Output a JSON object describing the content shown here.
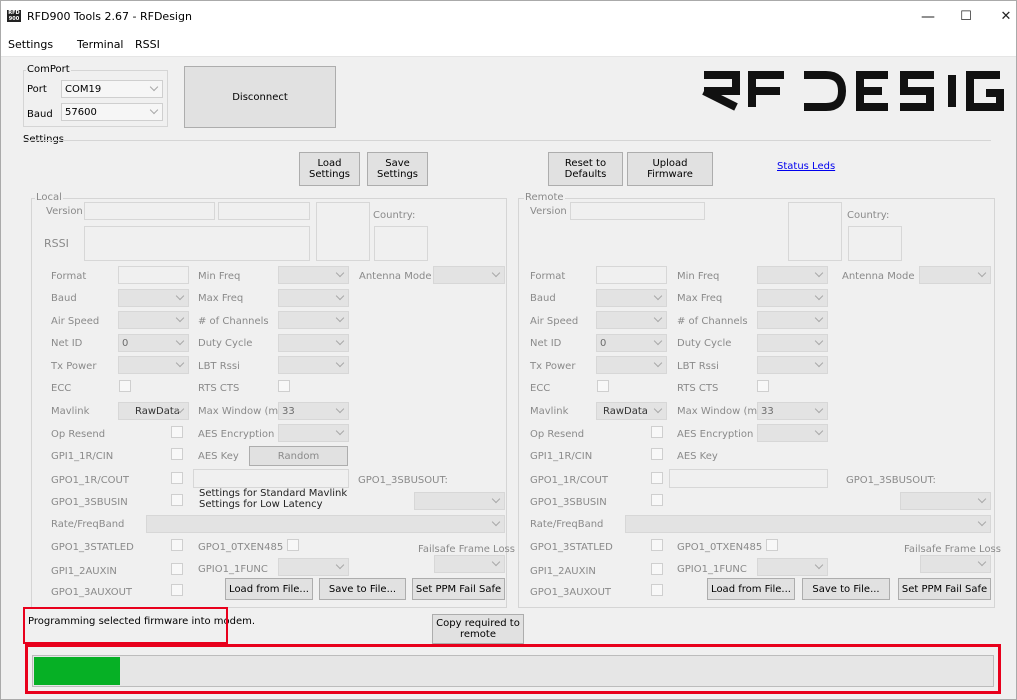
{
  "window": {
    "title": "RFD900 Tools 2.67 - RFDesign",
    "icon_text": "RFD\n900",
    "min_glyph": "—",
    "max_glyph": "☐",
    "close_glyph": "✕"
  },
  "menu": [
    "Settings",
    "Terminal",
    "RSSI"
  ],
  "comport": {
    "group": "ComPort",
    "port_label": "Port",
    "port_value": "COM19",
    "baud_label": "Baud",
    "baud_value": "57600",
    "disconnect": "Disconnect"
  },
  "logo": "RFDESIGN",
  "settings": {
    "group": "Settings",
    "load": "Load Settings",
    "save": "Save Settings",
    "reset": "Reset to Defaults",
    "upload": "Upload Firmware",
    "status_leds": "Status Leds"
  },
  "local": {
    "group": "Local",
    "version": "Version",
    "country": "Country:",
    "rssi": "RSSI",
    "format": "Format",
    "min_freq": "Min Freq",
    "antenna_mode": "Antenna Mode",
    "baud": "Baud",
    "max_freq": "Max Freq",
    "air_speed": "Air Speed",
    "channels": "# of Channels",
    "net_id": "Net ID",
    "net_id_value": "0",
    "duty_cycle": "Duty Cycle",
    "tx_power": "Tx Power",
    "lbt_rssi": "LBT Rssi",
    "ecc": "ECC",
    "rts_cts": "RTS CTS",
    "mavlink": "Mavlink",
    "mavlink_value": "RawData",
    "max_window": "Max Window (ms)",
    "max_window_value": "33",
    "op_resend": "Op Resend",
    "aes_enc": "AES Encryption",
    "gpi1": "GPI1_1R/CIN",
    "aes_key": "AES Key",
    "random": "Random",
    "gpo1_cout": "GPO1_1R/COUT",
    "sbusout": "GPO1_3SBUSOUT:",
    "sbusin": "GPO1_3SBUSIN",
    "std_mav": "Settings for Standard Mavlink",
    "low_lat": "Settings for Low Latency",
    "rate": "Rate/FreqBand",
    "statled": "GPO1_3STATLED",
    "txen": "GPO1_0TXEN485",
    "failsafe": "Failsafe Frame Loss",
    "auxin": "GPI1_2AUXIN",
    "func": "GPIO1_1FUNC",
    "auxout": "GPO1_3AUXOUT",
    "load_file": "Load from File...",
    "save_file": "Save to File...",
    "ppm": "Set PPM Fail Safe"
  },
  "remote": {
    "group": "Remote",
    "version": "Version",
    "country": "Country:",
    "format": "Format",
    "min_freq": "Min Freq",
    "antenna_mode": "Antenna Mode",
    "baud": "Baud",
    "max_freq": "Max Freq",
    "air_speed": "Air Speed",
    "channels": "# of Channels",
    "net_id": "Net ID",
    "net_id_value": "0",
    "duty_cycle": "Duty Cycle",
    "tx_power": "Tx Power",
    "lbt_rssi": "LBT Rssi",
    "ecc": "ECC",
    "rts_cts": "RTS CTS",
    "mavlink": "Mavlink",
    "mavlink_value": "RawData",
    "max_window": "Max Window (ms)",
    "max_window_value": "33",
    "op_resend": "Op Resend",
    "aes_enc": "AES Encryption",
    "gpi1": "GPI1_1R/CIN",
    "aes_key": "AES Key",
    "gpo1_cout": "GPO1_1R/COUT",
    "sbusout": "GPO1_3SBUSOUT:",
    "sbusin": "GPO1_3SBUSIN",
    "rate": "Rate/FreqBand",
    "statled": "GPO1_3STATLED",
    "txen": "GPO1_0TXEN485",
    "failsafe": "Failsafe Frame Loss",
    "auxin": "GPI1_2AUXIN",
    "func": "GPIO1_1FUNC",
    "auxout": "GPO1_3AUXOUT",
    "load_file": "Load from File...",
    "save_file": "Save to File...",
    "ppm": "Set PPM Fail Safe"
  },
  "status": {
    "message": "Programming selected firmware into modem.",
    "copy": "Copy required to remote",
    "progress_fraction": 0.09
  },
  "colors": {
    "progress": "#06b025",
    "highlight": "#e8001c",
    "link": "#0000ee"
  }
}
